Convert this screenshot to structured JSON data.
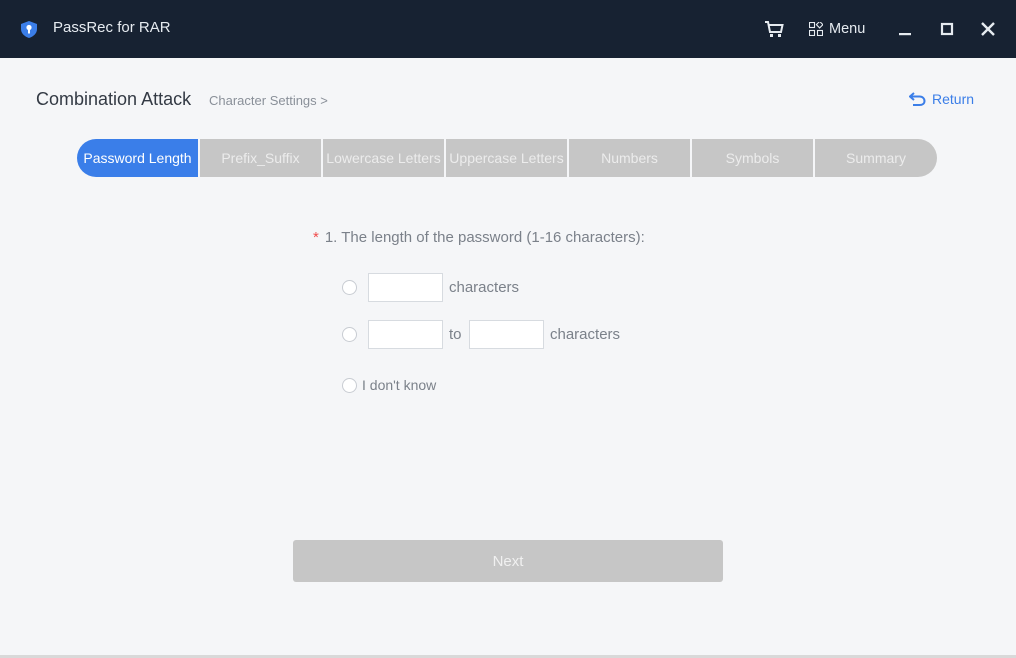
{
  "titlebar": {
    "app_title": "PassRec for RAR",
    "app_icon": "shield-key-icon",
    "cart_icon": "cart-icon",
    "menu_label": "Menu",
    "menu_icon": "grid-menu-icon",
    "minimize_icon": "minimize-icon",
    "maximize_icon": "maximize-icon",
    "close_icon": "close-icon"
  },
  "header": {
    "title": "Combination Attack",
    "breadcrumb": "Character Settings >",
    "return_label": "Return",
    "return_icon": "return-arrow-icon"
  },
  "steps": [
    {
      "label": "Password Length",
      "active": true
    },
    {
      "label": "Prefix_Suffix",
      "active": false
    },
    {
      "label": "Lowercase Letters",
      "active": false
    },
    {
      "label": "Uppercase Letters",
      "active": false
    },
    {
      "label": "Numbers",
      "active": false
    },
    {
      "label": "Symbols",
      "active": false
    },
    {
      "label": "Summary",
      "active": false
    }
  ],
  "form": {
    "required_mark": "*",
    "question": "1. The length of the password (1-16 characters):",
    "option_exact": {
      "value": "",
      "suffix": "characters"
    },
    "option_range": {
      "from_value": "",
      "to_label": "to",
      "to_value": "",
      "suffix": "characters"
    },
    "option_unknown": {
      "label": "I don't know"
    }
  },
  "footer": {
    "next_label": "Next"
  },
  "colors": {
    "accent": "#3a7ee9",
    "titlebar_bg": "#172232",
    "inactive_step": "#c6c6c6",
    "required": "#f04b4b"
  }
}
